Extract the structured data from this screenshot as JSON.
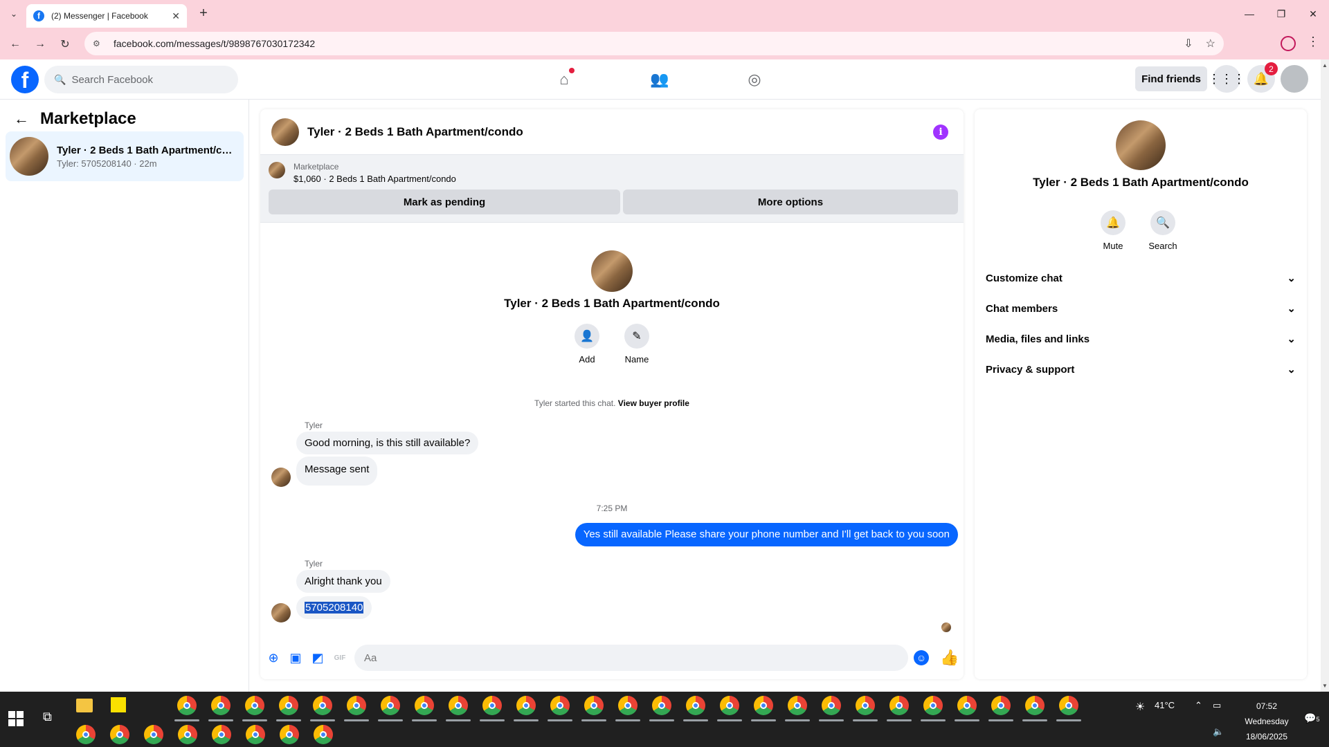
{
  "browser": {
    "tab_title": "(2) Messenger | Facebook",
    "url": "facebook.com/messages/t/9898767030172342"
  },
  "fbnav": {
    "search_placeholder": "Search Facebook",
    "find_friends": "Find friends",
    "notifications_count": "2"
  },
  "left_panel": {
    "title": "Marketplace",
    "conversations": [
      {
        "title": "Tyler · 2 Beds 1 Bath Apartment/co...",
        "subtitle": "Tyler: 5705208140 · 22m"
      }
    ]
  },
  "chat": {
    "title": "Tyler · 2 Beds 1 Bath Apartment/condo",
    "marketplace_label": "Marketplace",
    "listing": "$1,060 · 2 Beds 1 Bath Apartment/condo",
    "mark_pending": "Mark as pending",
    "more_options": "More options",
    "center_title": "Tyler · 2 Beds 1 Bath Apartment/condo",
    "add_label": "Add",
    "name_label": "Name",
    "started_text": "Tyler started this chat.",
    "view_buyer_profile": "View buyer profile",
    "sender1": "Tyler",
    "msg1": "Good morning, is this still available?",
    "msg2": "Message sent",
    "time": "7:25 PM",
    "outgoing": "Yes still available Please share your phone number and I'll get back to you soon",
    "sender2": "Tyler",
    "msg3": "Alright thank you",
    "msg4": "5705208140",
    "composer_placeholder": "Aa"
  },
  "right_panel": {
    "title": "Tyler · 2 Beds 1 Bath Apartment/condo",
    "mute": "Mute",
    "search": "Search",
    "rows": [
      "Customize chat",
      "Chat members",
      "Media, files and links",
      "Privacy & support"
    ]
  },
  "taskbar": {
    "temperature": "41°C",
    "time": "07:52",
    "day": "Wednesday",
    "date": "18/06/2025",
    "notif_count": "5"
  },
  "colors": {
    "facebook_blue": "#0866ff",
    "browser_frame": "#fbd3dc",
    "selected_conversation": "#ebf5ff",
    "info_purple": "#a033ff"
  }
}
